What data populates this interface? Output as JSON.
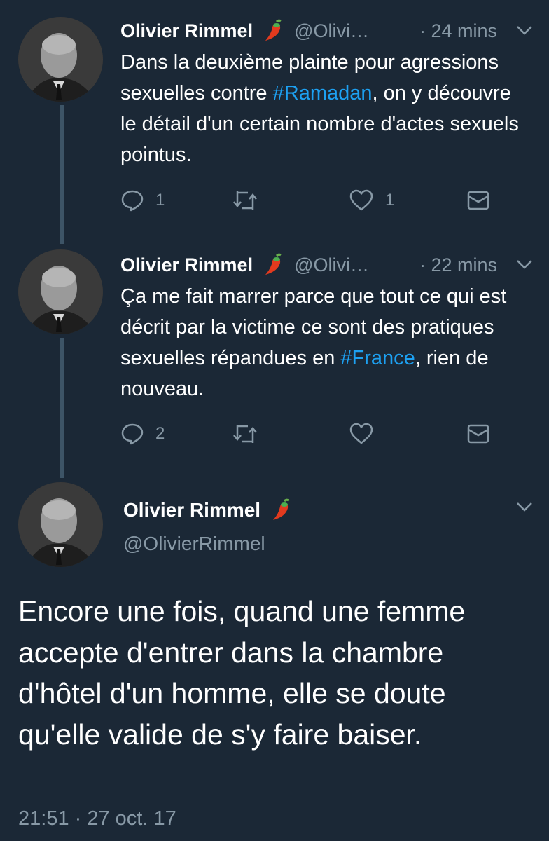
{
  "colors": {
    "background": "#1b2836",
    "text": "#ffffff",
    "secondary_text": "#8899a6",
    "link": "#1da1f2",
    "thread_line": "#3d5466"
  },
  "tweets": [
    {
      "name": "Olivier Rimmel",
      "name_icon": "pepper-icon",
      "handle": "@Olivi…",
      "time": "· 24 mins",
      "text": {
        "part1": "Dans la deuxième plainte pour agressions sexuelles contre ",
        "hashtag": "#Ramadan",
        "part2": ", on y découvre le détail d'un certain nombre d'actes sexuels pointus."
      },
      "actions": {
        "reply_count": "1",
        "retweet_count": "",
        "like_count": "1"
      }
    },
    {
      "name": "Olivier Rimmel",
      "name_icon": "pepper-icon",
      "handle": "@Olivi…",
      "time": "· 22 mins",
      "text": {
        "part1": "Ça me fait marrer parce que tout ce qui est décrit par la victime ce sont des pratiques sexuelles répandues en ",
        "hashtag": "#France",
        "part2": ", rien de nouveau."
      },
      "actions": {
        "reply_count": "2",
        "retweet_count": "",
        "like_count": ""
      }
    }
  ],
  "main_tweet": {
    "name": "Olivier Rimmel",
    "name_icon": "pepper-icon",
    "handle": "@OlivierRimmel",
    "text": "Encore une fois, quand une femme accepte d'entrer dans la chambre d'hôtel d'un homme, elle se doute qu'elle valide de s'y faire baiser.",
    "timestamp": "21:51 · 27 oct. 17"
  }
}
